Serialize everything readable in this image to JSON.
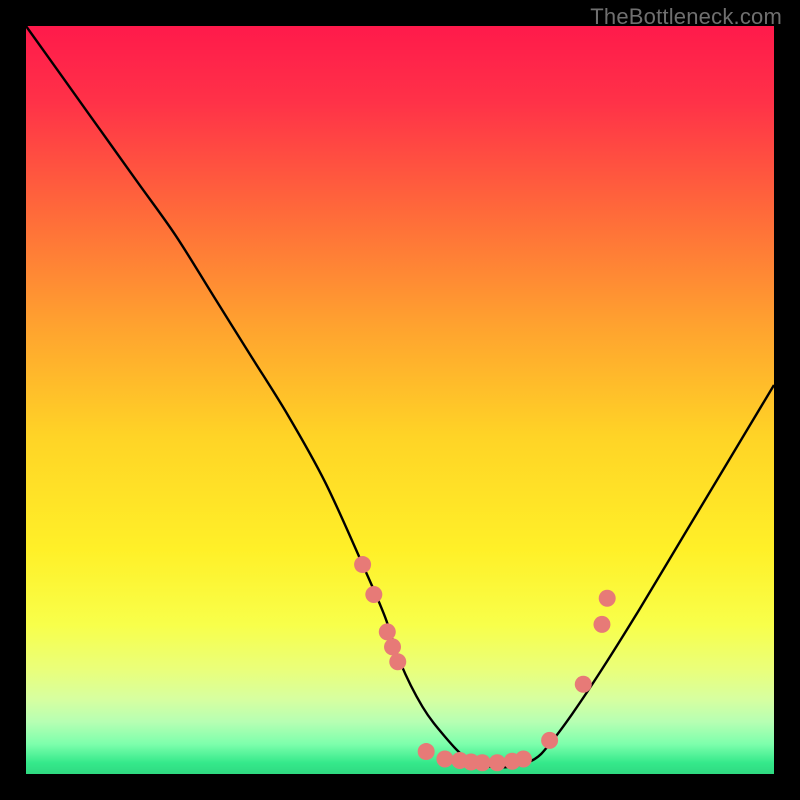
{
  "watermark": "TheBottleneck.com",
  "chart_data": {
    "type": "line",
    "title": "",
    "xlabel": "",
    "ylabel": "",
    "xlim": [
      0,
      100
    ],
    "ylim": [
      0,
      100
    ],
    "background_gradient": {
      "stops": [
        {
          "offset": 0.0,
          "color": "#ff1a4b"
        },
        {
          "offset": 0.1,
          "color": "#ff3148"
        },
        {
          "offset": 0.25,
          "color": "#ff6a3a"
        },
        {
          "offset": 0.4,
          "color": "#ffa22f"
        },
        {
          "offset": 0.55,
          "color": "#ffd426"
        },
        {
          "offset": 0.7,
          "color": "#fff028"
        },
        {
          "offset": 0.8,
          "color": "#f8ff4a"
        },
        {
          "offset": 0.86,
          "color": "#eaff7a"
        },
        {
          "offset": 0.9,
          "color": "#d7ffa0"
        },
        {
          "offset": 0.93,
          "color": "#b7ffb3"
        },
        {
          "offset": 0.96,
          "color": "#7dffac"
        },
        {
          "offset": 0.985,
          "color": "#35e98b"
        },
        {
          "offset": 1.0,
          "color": "#2fd981"
        }
      ]
    },
    "series": [
      {
        "name": "bottleneck-curve",
        "x": [
          0,
          5,
          10,
          15,
          20,
          25,
          30,
          35,
          40,
          45,
          48,
          50,
          53,
          56,
          59,
          62,
          65,
          68,
          70,
          73,
          77,
          82,
          88,
          94,
          100
        ],
        "y": [
          100,
          93,
          86,
          79,
          72,
          64,
          56,
          48,
          39,
          28,
          21,
          15,
          9,
          5,
          2,
          1,
          1,
          2,
          4,
          8,
          14,
          22,
          32,
          42,
          52
        ]
      }
    ],
    "scatter_points": {
      "name": "marker-dots",
      "color": "#e77a77",
      "radius": 8.5,
      "points": [
        {
          "x": 45.0,
          "y": 28.0
        },
        {
          "x": 46.5,
          "y": 24.0
        },
        {
          "x": 48.3,
          "y": 19.0
        },
        {
          "x": 49.0,
          "y": 17.0
        },
        {
          "x": 49.7,
          "y": 15.0
        },
        {
          "x": 53.5,
          "y": 3.0
        },
        {
          "x": 56.0,
          "y": 2.0
        },
        {
          "x": 58.0,
          "y": 1.8
        },
        {
          "x": 59.5,
          "y": 1.6
        },
        {
          "x": 61.0,
          "y": 1.5
        },
        {
          "x": 63.0,
          "y": 1.5
        },
        {
          "x": 65.0,
          "y": 1.7
        },
        {
          "x": 66.5,
          "y": 2.0
        },
        {
          "x": 70.0,
          "y": 4.5
        },
        {
          "x": 74.5,
          "y": 12.0
        },
        {
          "x": 77.0,
          "y": 20.0
        },
        {
          "x": 77.7,
          "y": 23.5
        }
      ]
    }
  }
}
